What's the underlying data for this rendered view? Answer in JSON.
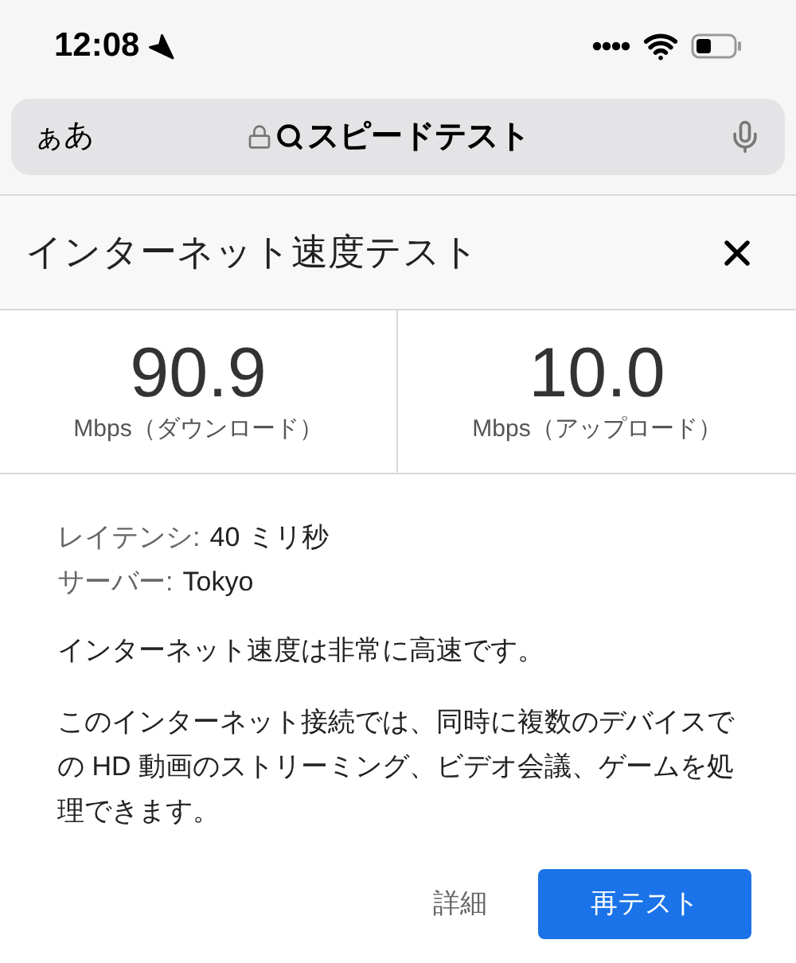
{
  "status_bar": {
    "time": "12:08"
  },
  "address_bar": {
    "label": "ぁあ",
    "query": "スピードテスト"
  },
  "card": {
    "title": "インターネット速度テスト",
    "speeds": [
      {
        "value": "90.9",
        "unit": "Mbps（ダウンロード）"
      },
      {
        "value": "10.0",
        "unit": "Mbps（アップロード）"
      }
    ],
    "details": [
      {
        "label": "レイテンシ:",
        "value": "40 ミリ秒"
      },
      {
        "label": "サーバー:",
        "value": "Tokyo"
      }
    ],
    "summary": "インターネット速度は非常に高速です。",
    "description": "このインターネット接続では、同時に複数のデバイスでの HD 動画のストリーミング、ビデオ会議、ゲームを処理できます。",
    "buttons": [
      {
        "label": "詳細",
        "kind": "text"
      },
      {
        "label": "再テスト",
        "kind": "primary"
      }
    ]
  }
}
